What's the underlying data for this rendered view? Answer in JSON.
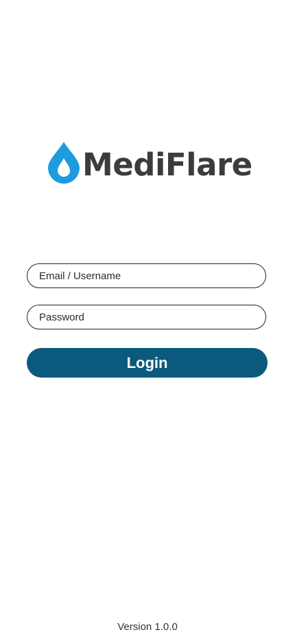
{
  "logo": {
    "icon": "water-drop-icon",
    "text": "MediFlare",
    "drop_color": "#1e9be0",
    "text_color": "#3c3c3c"
  },
  "form": {
    "email_placeholder": "Email / Username",
    "email_value": "",
    "password_placeholder": "Password",
    "password_value": "",
    "login_label": "Login",
    "button_color": "#0b5a7d"
  },
  "footer": {
    "version": "Version 1.0.0"
  }
}
